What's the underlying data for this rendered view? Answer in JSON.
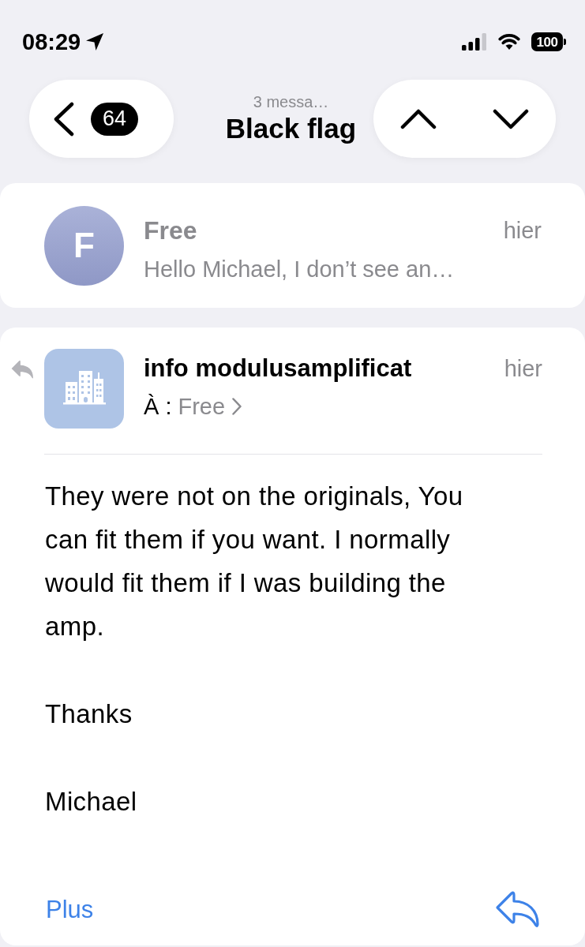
{
  "status_bar": {
    "time": "08:29",
    "battery": "100"
  },
  "nav": {
    "back_count": "64",
    "subtitle": "3 messa…",
    "title": "Black flag"
  },
  "messages": [
    {
      "kind": "collapsed",
      "avatar_letter": "F",
      "sender": "Free",
      "date": "hier",
      "preview": "Hello Michael, I don’t see an…"
    },
    {
      "kind": "expanded",
      "replied": true,
      "sender": "info modulusamplificat",
      "date": "hier",
      "to_label": "À :",
      "recipient": "Free",
      "body": [
        "They were not on the originals, You can fit them if you want. I normally would fit them if I was building the amp.",
        "Thanks",
        "Michael"
      ],
      "more_link": "Plus"
    }
  ]
}
